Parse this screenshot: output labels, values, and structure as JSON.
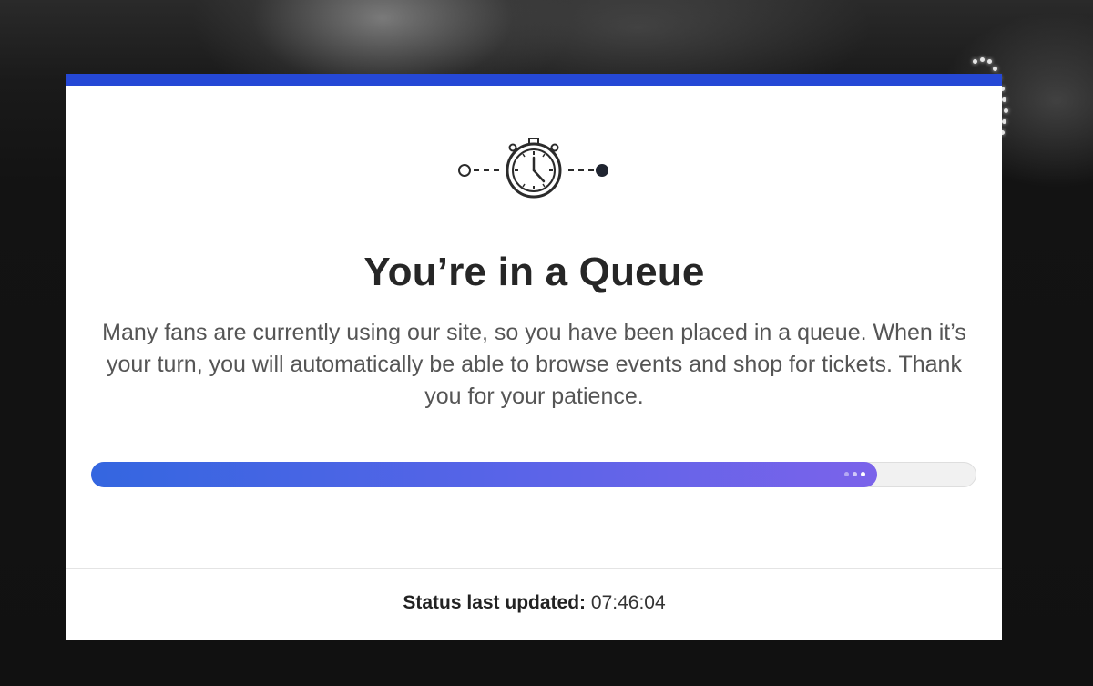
{
  "queue": {
    "title": "You’re in a Queue",
    "message": "Many fans are currently using our site, so you have been placed in a queue. When it’s your turn, you will automatically be able to browse events and shop for tickets. Thank you for your patience.",
    "icon": "stopwatch-icon",
    "progress": 0.89,
    "status_label": "Status last updated:",
    "status_time": "07:46:04"
  },
  "colors": {
    "accent_bar": "#2548d6",
    "progress_start": "#3466e0",
    "progress_end": "#7b63ea",
    "title_text": "#262626",
    "body_text": "#555555"
  }
}
